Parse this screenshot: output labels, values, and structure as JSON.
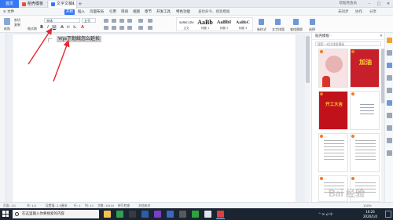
{
  "titlebar": {
    "home": "首页",
    "tabs": [
      {
        "label": "稻壳模板",
        "icon_color": "#e94b35"
      },
      {
        "label": "文字文稿1",
        "icon_color": "#3478f6"
      }
    ],
    "new_tab": "+",
    "login": "玩稻壳会员",
    "win": [
      "–",
      "□",
      "✕"
    ]
  },
  "menubar": {
    "file": "≡ 文件",
    "items": [
      "开始",
      "插入",
      "页面布局",
      "引用",
      "审阅",
      "视图",
      "章节",
      "开发工具",
      "特色功能",
      "查找命令、搜索模板"
    ],
    "active": "开始",
    "right": [
      "未同步",
      "协作",
      "分享"
    ]
  },
  "ribbon": {
    "paste": "粘贴",
    "format_painter": "格式刷",
    "cut": "剪切",
    "copy": "复制",
    "font_name": "宋体",
    "font_size": "五号",
    "fmt": [
      "B",
      "I",
      "U",
      "A",
      "X²",
      "X₂",
      "A"
    ],
    "styles": [
      {
        "sample": "AaBbCcDd",
        "name": "正文"
      },
      {
        "sample": "AaBb",
        "name": "标题 1"
      },
      {
        "sample": "AaBbI",
        "name": "标题 2"
      },
      {
        "sample": "AaBbC",
        "name": "标题 3"
      }
    ],
    "tools": [
      "新样式",
      "文字排版",
      "查找替换",
      "选择"
    ]
  },
  "document": {
    "text": "Wps下划线怎么延长"
  },
  "panel": {
    "title": "稻壳模板 ·",
    "close": "✕",
    "search_placeholder": "搜索一对比排版模板",
    "templates": [
      {
        "color": "#f6e3e3",
        "accent": "#d9342b",
        "text": ""
      },
      {
        "color": "#c8202a",
        "accent": "#ffd23c",
        "text": "加油"
      },
      {
        "color": "#c1121c",
        "accent": "#ffd23c",
        "text": "开工大吉"
      },
      {
        "color": "#ffffff",
        "accent": "#9aa3b0",
        "text": ""
      },
      {
        "color": "#ffffff",
        "accent": "#b5b5b5",
        "text": ""
      },
      {
        "color": "#ffffff",
        "accent": "#b5b5b5",
        "text": ""
      },
      {
        "color": "#ffffff",
        "accent": "#b5b5b5",
        "text": ""
      },
      {
        "color": "#ffffff",
        "accent": "#b5b5b5",
        "text": ""
      }
    ]
  },
  "statusbar": {
    "page": "页面: 1/1",
    "section": "节: 1/1",
    "position": "设置值: 2.5厘米",
    "row": "行: 1",
    "col": "列: 11",
    "words": "字数: 10/10",
    "spell": "拼写检查",
    "protect": "文档校对",
    "zoom": "100%"
  },
  "taskbar": {
    "search_placeholder": "在这里输入你要搜索的内容",
    "apps": [
      {
        "color": "#f2c14e"
      },
      {
        "color": "#30a14e"
      },
      {
        "color": "#3a3a3a"
      },
      {
        "color": "#2b5ea7"
      },
      {
        "color": "#7b3fc4"
      },
      {
        "color": "#3a66c4"
      },
      {
        "color": "#5a5a5a"
      },
      {
        "color": "#2aa43b"
      },
      {
        "color": "#dfe6ef"
      },
      {
        "color": "#d64141"
      }
    ],
    "tray": "^ ✉ ◂) 中",
    "time": "16:26",
    "date": "2020/1/4"
  },
  "colors": {
    "accent": "#3478f6",
    "arrow": "#e8262e"
  },
  "watermark": "Bai 经验"
}
